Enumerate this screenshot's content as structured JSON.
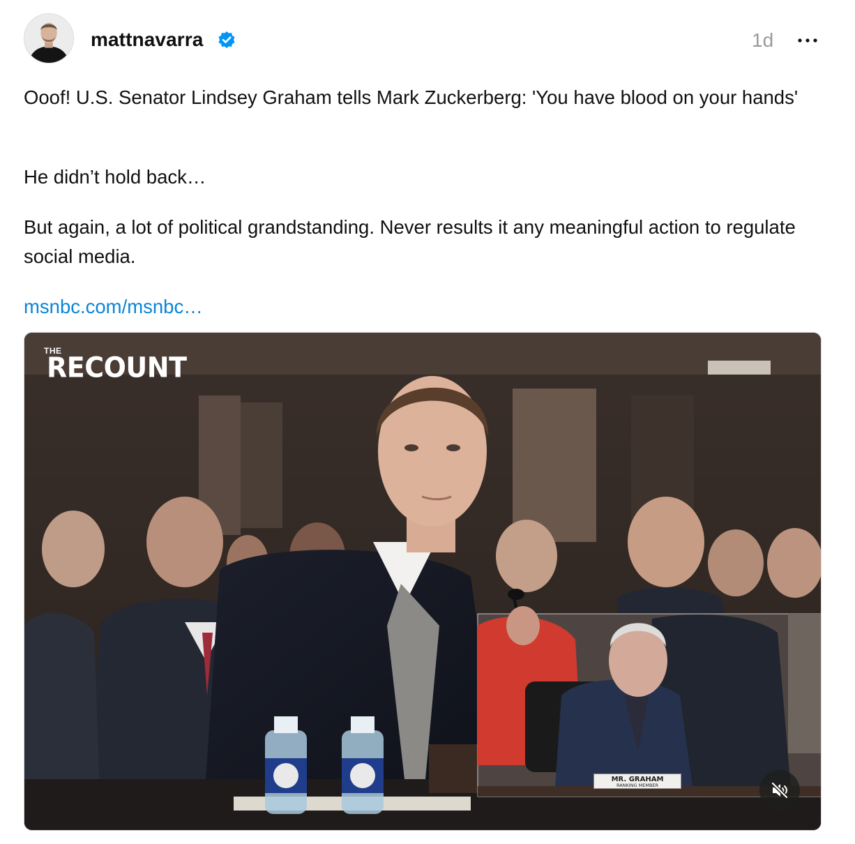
{
  "post": {
    "username": "mattnavarra",
    "verified": true,
    "timestamp": "1d",
    "paragraphs": [
      "Ooof! U.S. Senator Lindsey Graham tells Mark Zuckerberg: 'You have blood on your hands'",
      "He didn’t hold back…",
      "But again, a lot of political grandstanding. Never results it any meaningful action to regulate social media."
    ],
    "link_text": "msnbc.com/msnbc…"
  },
  "video": {
    "logo_small": "THE",
    "logo_main": "RECOUNT",
    "placard_name": "MR. GRAHAM",
    "placard_title": "RANKING MEMBER",
    "muted": true
  },
  "icons": {
    "verified": "verified-badge-icon",
    "more": "more-options-icon",
    "mute": "speaker-muted-icon"
  },
  "colors": {
    "link": "#0a84d8",
    "verified": "#0095f6",
    "timestamp": "#9a9a9a"
  }
}
